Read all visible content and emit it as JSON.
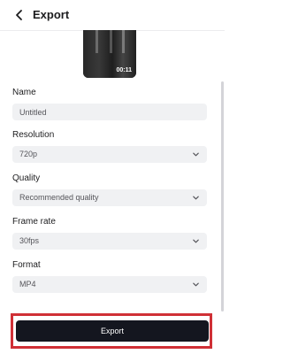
{
  "header": {
    "back_icon": "chevron-left-icon",
    "title": "Export"
  },
  "preview": {
    "duration": "00:11"
  },
  "fields": {
    "name": {
      "label": "Name",
      "value": "Untitled"
    },
    "resolution": {
      "label": "Resolution",
      "value": "720p",
      "icon": "chevron-down-icon"
    },
    "quality": {
      "label": "Quality",
      "value": "Recommended quality",
      "icon": "chevron-down-icon"
    },
    "frame_rate": {
      "label": "Frame rate",
      "value": "30fps",
      "icon": "chevron-down-icon"
    },
    "format": {
      "label": "Format",
      "value": "MP4",
      "icon": "chevron-down-icon"
    }
  },
  "actions": {
    "export_label": "Export",
    "highlight_color": "#d03036",
    "button_color": "#14161f"
  }
}
